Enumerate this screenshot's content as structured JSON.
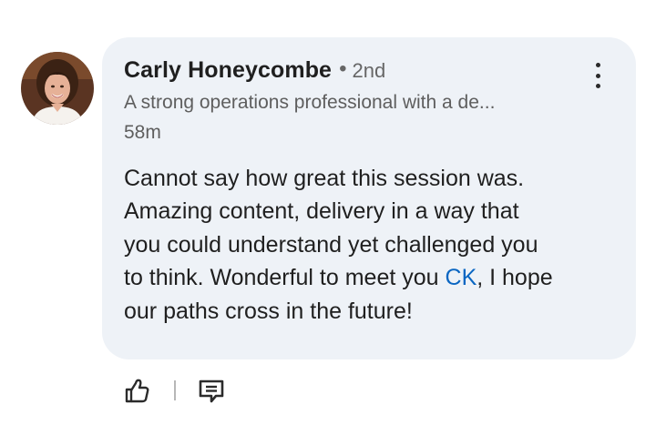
{
  "comment": {
    "author": {
      "name": "Carly Honeycombe",
      "connection_degree": "2nd",
      "separator": "•",
      "headline": "A strong operations professional with a de...",
      "avatar_icon": "profile-photo"
    },
    "timestamp": "58m",
    "body": {
      "line1": "Cannot say how great this session was.",
      "line2": "Amazing content, delivery in a way that",
      "line3": "you could understand yet challenged you",
      "line4_before_mention": "to think. Wonderful to meet you ",
      "mention": "CK",
      "line4_after_mention": ", I hope",
      "line5": "our paths cross in the future!"
    },
    "more_options_icon": "vertical-ellipsis-icon"
  },
  "actions": {
    "like_icon": "thumbs-up-icon",
    "reply_icon": "comment-icon"
  },
  "colors": {
    "bubble_background": "#eef2f7",
    "mention_blue": "#0a66c2",
    "primary_text": "#1f1f1f",
    "secondary_text": "#5e5e5e"
  }
}
